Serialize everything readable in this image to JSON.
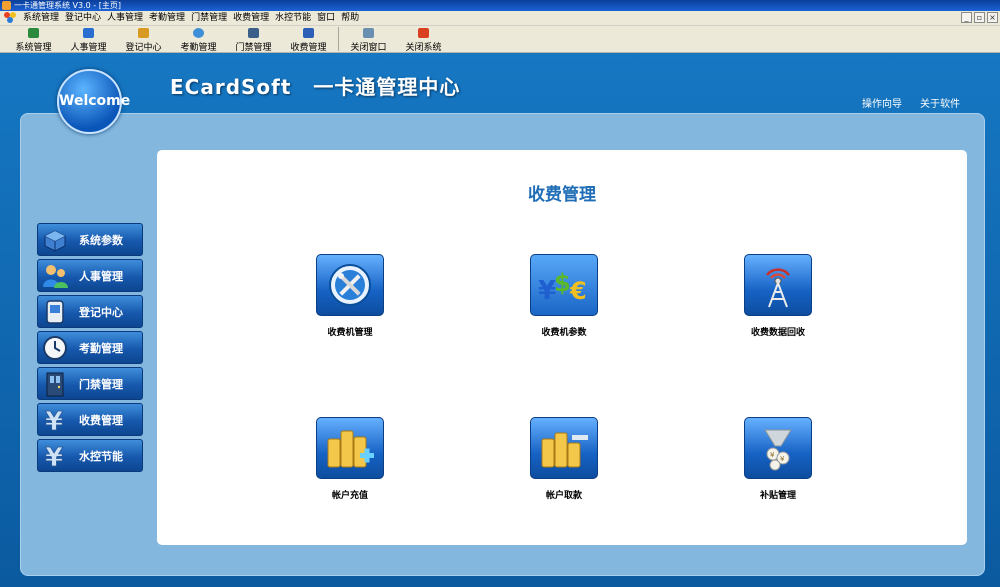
{
  "window": {
    "title": "一卡通管理系统  V3.0 - [主页]"
  },
  "menubar": {
    "items": [
      "系统管理",
      "登记中心",
      "人事管理",
      "考勤管理",
      "门禁管理",
      "收费管理",
      "水控节能",
      "窗口",
      "帮助"
    ]
  },
  "window_controls": {
    "minimize": "_",
    "restore": "▫",
    "close": "×"
  },
  "toolbar": {
    "items": [
      {
        "label": "系统管理",
        "icon": "system-icon",
        "color": "#2c8a3c"
      },
      {
        "label": "人事管理",
        "icon": "person-icon",
        "color": "#2a6fd0"
      },
      {
        "label": "登记中心",
        "icon": "register-icon",
        "color": "#d89a20"
      },
      {
        "label": "考勤管理",
        "icon": "clock-icon",
        "color": "#3f8fd8"
      },
      {
        "label": "门禁管理",
        "icon": "door-icon",
        "color": "#3a5f88"
      },
      {
        "label": "收费管理",
        "icon": "yen-icon",
        "color": "#2e5fb8"
      },
      {
        "label": "关闭窗口",
        "icon": "close-window-icon",
        "color": "#6a8fb0"
      },
      {
        "label": "关闭系统",
        "icon": "power-icon",
        "color": "#d84020"
      }
    ]
  },
  "header": {
    "brand_en": "ECardSoft",
    "brand_cn": "一卡通管理中心",
    "welcome": "Welcome",
    "links": [
      "操作向导",
      "关于软件"
    ]
  },
  "sidebar": {
    "items": [
      {
        "label": "系统参数",
        "icon": "system-cube-icon"
      },
      {
        "label": "人事管理",
        "icon": "people-icon"
      },
      {
        "label": "登记中心",
        "icon": "card-reader-icon"
      },
      {
        "label": "考勤管理",
        "icon": "clock-icon"
      },
      {
        "label": "门禁管理",
        "icon": "door-icon"
      },
      {
        "label": "收费管理",
        "icon": "yen-icon"
      },
      {
        "label": "水控节能",
        "icon": "water-yen-icon"
      }
    ]
  },
  "content": {
    "title": "收费管理",
    "tiles": [
      {
        "label": "收费机管理",
        "icon": "tools-icon"
      },
      {
        "label": "收费机参数",
        "icon": "currency-icon"
      },
      {
        "label": "收费数据回收",
        "icon": "antenna-icon"
      },
      {
        "label": "帐户充值",
        "icon": "coins-plus-icon"
      },
      {
        "label": "帐户取款",
        "icon": "coins-minus-icon"
      },
      {
        "label": "补贴管理",
        "icon": "subsidy-icon"
      }
    ]
  },
  "colors": {
    "background": "#0d5fa3",
    "frame": "#84b7dd",
    "title_text": "#1f6db6"
  }
}
